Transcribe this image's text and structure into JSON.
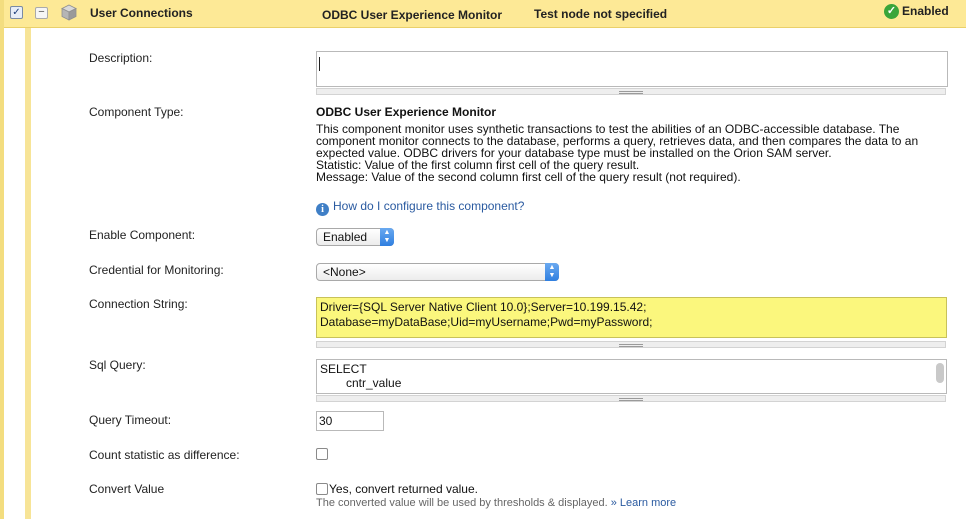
{
  "header": {
    "title": "User Connections",
    "component_type": "ODBC User Experience Monitor",
    "node": "Test node not specified",
    "status": "Enabled",
    "checked": "✓",
    "collapse": "−"
  },
  "fields": {
    "description": {
      "label": "Description:",
      "value": ""
    },
    "component_type": {
      "label": "Component Type:",
      "title": "ODBC User Experience Monitor",
      "description_lines": [
        "This component monitor uses synthetic transactions to test the abilities of an ODBC-accessible database. The",
        "component monitor connects to the database, performs a query, retrieves data, and then compares the data to an",
        "expected value. ODBC drivers for your database type must be installed on the Orion SAM server.",
        "Statistic: Value of the first column first cell of the query result.",
        "Message: Value of the second column first cell of the query result (not required)."
      ],
      "help_link": "How do I configure this component?"
    },
    "enable_component": {
      "label": "Enable Component:",
      "value": "Enabled"
    },
    "credential": {
      "label": "Credential for Monitoring:",
      "value": "<None>"
    },
    "connection_string": {
      "label": "Connection String:",
      "lines": [
        "Driver={SQL Server Native Client 10.0};Server=10.199.15.42;",
        "Database=myDataBase;Uid=myUsername;Pwd=myPassword;"
      ]
    },
    "sql_query": {
      "label": "Sql Query:",
      "lines": [
        "SELECT",
        "cntr_value"
      ]
    },
    "query_timeout": {
      "label": "Query Timeout:",
      "value": "30"
    },
    "count_difference": {
      "label": "Count statistic as difference:",
      "checked": false
    },
    "convert_value": {
      "label": "Convert Value",
      "checkbox_text": "Yes, convert returned value.",
      "note": "The converted value will be used by thresholds & displayed.",
      "learn_more": "» Learn more"
    }
  },
  "colors": {
    "header_bg": "#fde996",
    "connection_bg": "#fbf77d",
    "link": "#2a5aa0",
    "status_green": "#3aa53a"
  },
  "icons": {
    "status": "check-circle-icon",
    "cube": "cube-icon",
    "info": "info-icon",
    "select_arrow": "updown-arrow-icon"
  }
}
